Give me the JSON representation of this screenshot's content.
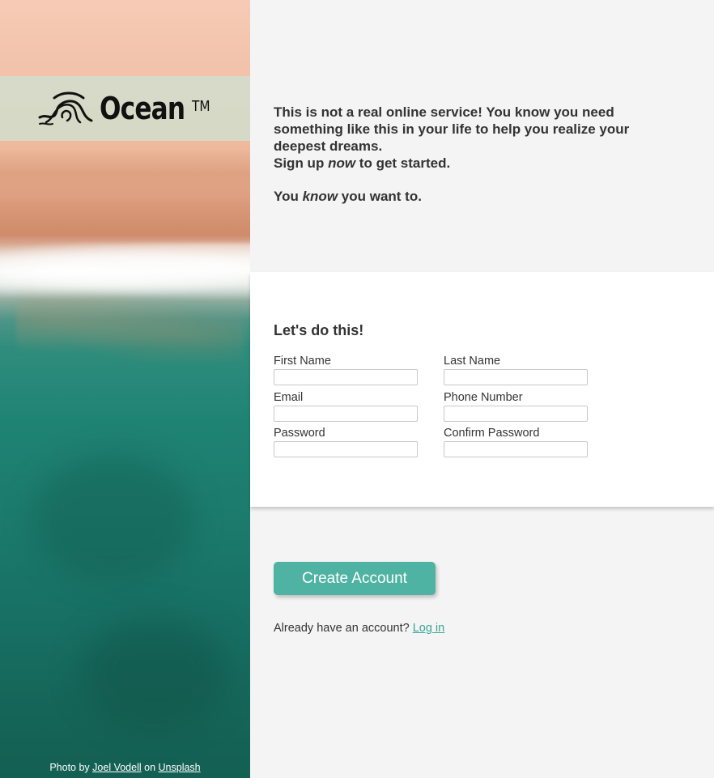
{
  "brand": {
    "name": "Ocean",
    "trademark": "TM"
  },
  "photo_credit": {
    "prefix": "Photo by",
    "author": "Joel Vodell",
    "middle": "on",
    "site": "Unsplash"
  },
  "intro": {
    "line1": "This is not a real online service! You know you need something like this in your life to help you realize your deepest dreams.",
    "line2_before": "Sign up",
    "line2_em": "now",
    "line2_after": "to get started.",
    "line3_before": "You",
    "line3_em": "know",
    "line3_after": "you want to."
  },
  "form": {
    "title": "Let's do this!",
    "fields": {
      "first_name": {
        "label": "First Name",
        "value": ""
      },
      "last_name": {
        "label": "Last Name",
        "value": ""
      },
      "email": {
        "label": "Email",
        "value": ""
      },
      "phone": {
        "label": "Phone Number",
        "value": ""
      },
      "password": {
        "label": "Password",
        "value": ""
      },
      "confirm_password": {
        "label": "Confirm Password",
        "value": ""
      }
    }
  },
  "actions": {
    "create_label": "Create Account",
    "login_prompt": "Already have an account?",
    "login_link": "Log in"
  },
  "colors": {
    "accent": "#4fb3a3",
    "link": "#3aa596",
    "text": "#333333",
    "background": "#f4f4f4"
  }
}
